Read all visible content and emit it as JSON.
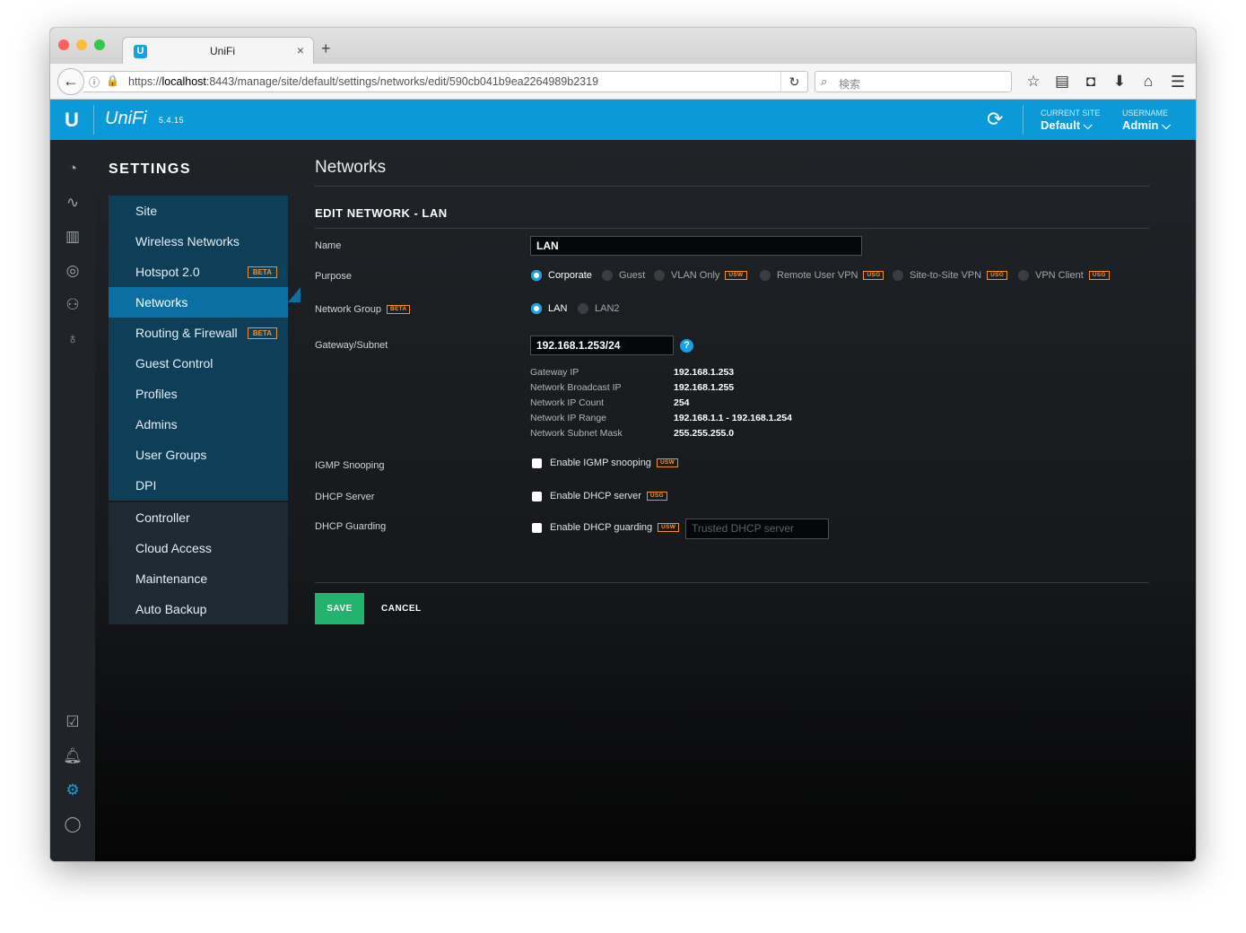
{
  "browser": {
    "tab_title": "UniFi",
    "url_prefix": "https://",
    "url_host": "localhost",
    "url_path": ":8443/manage/site/default/settings/networks/edit/590cb041b9ea2264989b2319",
    "search_placeholder": "検索"
  },
  "app": {
    "brand": "UniFi",
    "version": "5.4.15",
    "current_site_label": "CURRENT SITE",
    "current_site_value": "Default",
    "username_label": "USERNAME",
    "username_value": "Admin"
  },
  "settings_menu": {
    "title": "SETTINGS",
    "items": [
      {
        "label": "Site"
      },
      {
        "label": "Wireless Networks"
      },
      {
        "label": "Hotspot 2.0",
        "badge": "BETA"
      },
      {
        "label": "Networks",
        "active": true
      },
      {
        "label": "Routing & Firewall",
        "badge": "BETA"
      },
      {
        "label": "Guest Control"
      },
      {
        "label": "Profiles"
      },
      {
        "label": "Admins"
      },
      {
        "label": "User Groups"
      },
      {
        "label": "DPI"
      }
    ],
    "items2": [
      {
        "label": "Controller"
      },
      {
        "label": "Cloud Access"
      },
      {
        "label": "Maintenance"
      },
      {
        "label": "Auto Backup"
      }
    ]
  },
  "page": {
    "title": "Networks",
    "section_title": "EDIT NETWORK - LAN",
    "name_label": "Name",
    "name_value": "LAN",
    "purpose_label": "Purpose",
    "purpose_options": [
      {
        "label": "Corporate",
        "selected": true
      },
      {
        "label": "Guest"
      },
      {
        "label": "VLAN Only",
        "tag": "USW"
      },
      {
        "label": "Remote User VPN",
        "tag": "USG"
      },
      {
        "label": "Site-to-Site VPN",
        "tag": "USG"
      },
      {
        "label": "VPN Client",
        "tag": "USG"
      }
    ],
    "network_group_label": "Network Group",
    "network_group_tag": "BETA",
    "network_group_options": [
      {
        "label": "LAN",
        "selected": true
      },
      {
        "label": "LAN2"
      }
    ],
    "gateway_label": "Gateway/Subnet",
    "gateway_value": "192.168.1.253/24",
    "help_icon": "?",
    "info": {
      "gateway_ip_label": "Gateway IP",
      "gateway_ip": "192.168.1.253",
      "broadcast_label": "Network Broadcast IP",
      "broadcast": "192.168.1.255",
      "count_label": "Network IP Count",
      "count": "254",
      "range_label": "Network IP Range",
      "range": "192.168.1.1 - 192.168.1.254",
      "mask_label": "Network Subnet Mask",
      "mask": "255.255.255.0"
    },
    "igmp_label": "IGMP Snooping",
    "igmp_check": "Enable IGMP snooping",
    "igmp_tag": "USW",
    "dhcp_server_label": "DHCP Server",
    "dhcp_server_check": "Enable DHCP server",
    "dhcp_server_tag": "USG",
    "dhcp_guard_label": "DHCP Guarding",
    "dhcp_guard_check": "Enable DHCP guarding",
    "dhcp_guard_tag": "USW",
    "trusted_placeholder": "Trusted DHCP server",
    "save_label": "SAVE",
    "cancel_label": "CANCEL"
  },
  "colors": {
    "accent": "#0b9ad7",
    "active_menu": "#0c6fa3",
    "menu_bg": "#0f3e59",
    "save": "#23b36f",
    "tag": "#f29228"
  }
}
